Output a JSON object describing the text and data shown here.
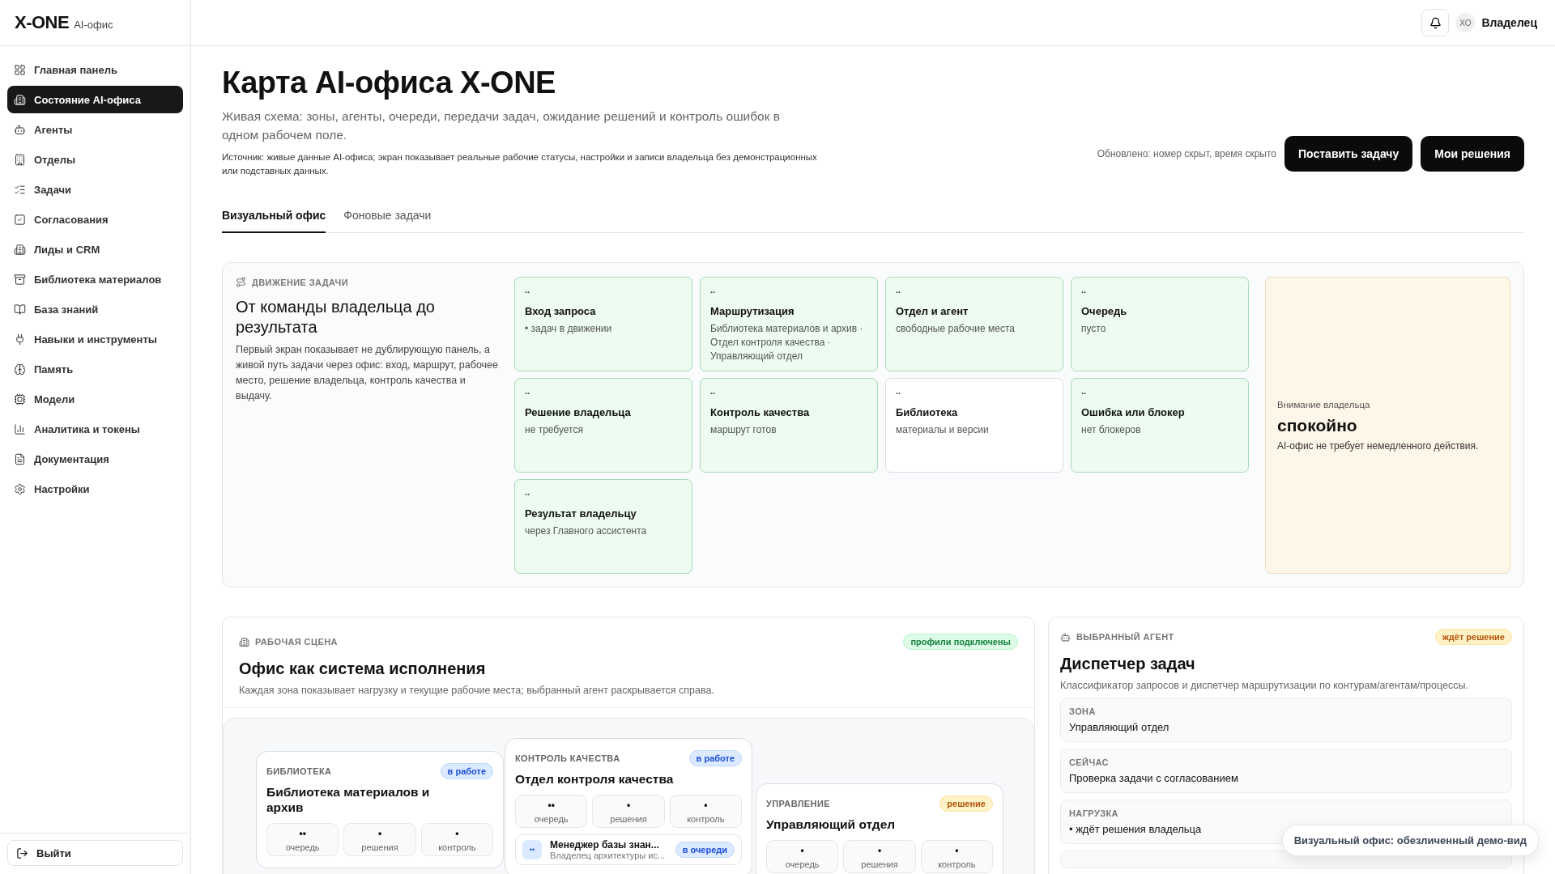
{
  "brand": {
    "name": "X-ONE",
    "sub": "AI-офис"
  },
  "sidebar": {
    "items": [
      {
        "label": "Главная панель",
        "selected": false
      },
      {
        "label": "Состояние AI-офиса",
        "selected": true
      },
      {
        "label": "Агенты",
        "selected": false
      },
      {
        "label": "Отделы",
        "selected": false
      },
      {
        "label": "Задачи",
        "selected": false
      },
      {
        "label": "Согласования",
        "selected": false
      },
      {
        "label": "Лиды и CRM",
        "selected": false
      },
      {
        "label": "Библиотека материалов",
        "selected": false
      },
      {
        "label": "База знаний",
        "selected": false
      },
      {
        "label": "Навыки и инструменты",
        "selected": false
      },
      {
        "label": "Память",
        "selected": false
      },
      {
        "label": "Модели",
        "selected": false
      },
      {
        "label": "Аналитика и токены",
        "selected": false
      },
      {
        "label": "Документация",
        "selected": false
      },
      {
        "label": "Настройки",
        "selected": false
      }
    ],
    "logout": "Выйти"
  },
  "topbar": {
    "avatar": "XO",
    "user": "Владелец"
  },
  "page": {
    "title": "Карта AI-офиса X-ONE",
    "subtitle": "Живая схема: зоны, агенты, очереди, передачи задач, ожидание решений и контроль ошибок в одном рабочем поле.",
    "source": "Источник: живые данные AI-офиса; экран показывает реальные рабочие статусы, настройки и записи владельца без демонстрационных или подставных данных.",
    "updated": "Обновлено: номер скрыт, время скрыто",
    "buttons": [
      "Поставить задачу",
      "Мои решения"
    ]
  },
  "tabs": [
    {
      "label": "Визуальный офис",
      "selected": true
    },
    {
      "label": "Фоновые задачи",
      "selected": false
    }
  ],
  "flow": {
    "eyebrow": "ДВИЖЕНИЕ ЗАДАЧИ",
    "title": "От команды владельца до результата",
    "text": "Первый экран показывает не дублирующую панель, а живой путь задачи через офис: вход, маршрут, рабочее место, решение владельца, контроль качества и выдачу.",
    "steps": [
      {
        "mark": "..",
        "title": "Вход запроса",
        "sub": "• задач в движении",
        "active": true
      },
      {
        "mark": "..",
        "title": "Маршрутизация",
        "sub": "Библиотека материалов и архив · Отдел контроля качества · Управляющий отдел",
        "active": true
      },
      {
        "mark": "..",
        "title": "Отдел и агент",
        "sub": "свободные рабочие места",
        "active": true
      },
      {
        "mark": "..",
        "title": "Очередь",
        "sub": "пусто",
        "active": true
      },
      {
        "mark": "..",
        "title": "Решение владельца",
        "sub": "не требуется",
        "active": true
      },
      {
        "mark": "..",
        "title": "Контроль качества",
        "sub": "маршрут готов",
        "active": true
      },
      {
        "mark": "..",
        "title": "Библиотека",
        "sub": "материалы и версии",
        "active": false
      },
      {
        "mark": "..",
        "title": "Ошибка или блокер",
        "sub": "нет блокеров",
        "active": true
      },
      {
        "mark": "..",
        "title": "Результат владельцу",
        "sub": "через Главного ассистента",
        "active": true
      }
    ],
    "attention": {
      "label": "Внимание владельца",
      "state": "спокойно",
      "text": "AI-офис не требует немедленного действия."
    }
  },
  "scene": {
    "eyebrow": "РАБОЧАЯ СЦЕНА",
    "badge": {
      "text": "профили подключены",
      "kind": "ok"
    },
    "title": "Офис как система исполнения",
    "text": "Каждая зона показывает нагрузку и текущие рабочие места; выбранный агент раскрывается справа.",
    "zones": [
      {
        "eyebrow": "БИБЛИОТЕКА",
        "title": "Библиотека материалов и архив",
        "badge": {
          "text": "в работе",
          "kind": "work"
        },
        "stats": [
          {
            "value": "••",
            "label": "очередь"
          },
          {
            "value": "•",
            "label": "решения"
          },
          {
            "value": "•",
            "label": "контроль"
          }
        ]
      },
      {
        "eyebrow": "КОНТРОЛЬ КАЧЕСТВА",
        "title": "Отдел контроля качества",
        "badge": {
          "text": "в работе",
          "kind": "work"
        },
        "stats": [
          {
            "value": "••",
            "label": "очередь"
          },
          {
            "value": "•",
            "label": "решения"
          },
          {
            "value": "•",
            "label": "контроль"
          }
        ],
        "agents": [
          {
            "avatar": "••",
            "name": "Менеджер базы знан...",
            "role": "Владелец архитектуры ис...",
            "badge": {
              "text": "в очереди",
              "kind": "work"
            }
          }
        ]
      },
      {
        "eyebrow": "УПРАВЛЕНИЕ",
        "title": "Управляющий отдел",
        "badge": {
          "text": "решение",
          "kind": "decision"
        },
        "stats": [
          {
            "value": "•",
            "label": "очередь"
          },
          {
            "value": "•",
            "label": "решения"
          },
          {
            "value": "•",
            "label": "контроль"
          }
        ]
      }
    ]
  },
  "agent": {
    "eyebrow": "ВЫБРАННЫЙ АГЕНТ",
    "badge": {
      "text": "ждёт решение",
      "kind": "decision"
    },
    "title": "Диспетчер задач",
    "text": "Классификатор запросов и диспетчер маршрутизации по контурам/агентам/процессы.",
    "fields": [
      {
        "label": "ЗОНА",
        "value": "Управляющий отдел"
      },
      {
        "label": "СЕЙЧАС",
        "value": "Проверка задачи с согласованием"
      },
      {
        "label": "НАГРУЗКА",
        "value": "• ждёт решения владельца"
      }
    ]
  },
  "toast": "Визуальный офис: обезличенный демо-вид"
}
